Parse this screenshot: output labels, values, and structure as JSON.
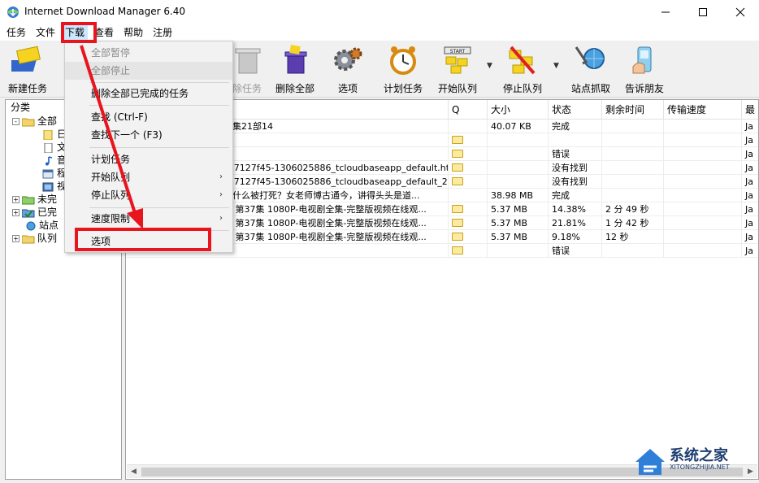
{
  "window": {
    "title": "Internet Download Manager 6.40"
  },
  "menubar": [
    "任务",
    "文件",
    "下载",
    "查看",
    "帮助",
    "注册"
  ],
  "toolbar": {
    "buttons": [
      {
        "label": "新建任务",
        "icon": "new-task-icon"
      },
      {
        "label": "除任务",
        "icon": "delete-task-icon"
      },
      {
        "label": "删除全部",
        "icon": "delete-all-icon"
      },
      {
        "label": "选项",
        "icon": "options-gear-icon"
      },
      {
        "label": "计划任务",
        "icon": "scheduler-clock-icon"
      },
      {
        "label": "开始队列",
        "icon": "start-queue-icon"
      },
      {
        "label": "停止队列",
        "icon": "stop-queue-icon"
      },
      {
        "label": "站点抓取",
        "icon": "site-grabber-icon"
      },
      {
        "label": "告诉朋友",
        "icon": "tell-friend-icon"
      }
    ]
  },
  "left_panel": {
    "header": "分类",
    "tree": [
      {
        "label": "全部",
        "expander": "-"
      },
      {
        "label": "日"
      },
      {
        "label": "文"
      },
      {
        "label": "音"
      },
      {
        "label": "程"
      },
      {
        "label": "视"
      },
      {
        "label": "未完",
        "expander": "+"
      },
      {
        "label": "已完",
        "expander": "+"
      },
      {
        "label": "站点"
      },
      {
        "label": "队列",
        "expander": "+"
      }
    ]
  },
  "file_list": {
    "columns": [
      "Q",
      "大小",
      "状态",
      "剩余时间",
      "传输速度",
      "最"
    ],
    "rows": [
      {
        "name": "合集21部14",
        "q": false,
        "size": "40.07 KB",
        "status": "完成",
        "remaining": "",
        "speed": "",
        "last": "Ja"
      },
      {
        "name": "",
        "q": true,
        "size": "",
        "status": "",
        "remaining": "",
        "speed": "",
        "last": "Ja"
      },
      {
        "name": "",
        "q": true,
        "size": "",
        "status": "错误",
        "remaining": "",
        "speed": "",
        "last": "Ja"
      },
      {
        "name": "s07127f45-1306025886_tcloudbaseapp_default.html",
        "q": true,
        "size": "",
        "status": "没有找到",
        "remaining": "",
        "speed": "",
        "last": "Ja"
      },
      {
        "name": "s07127f45-1306025886_tcloudbaseapp_default_2....",
        "q": true,
        "size": "",
        "status": "没有找到",
        "remaining": "",
        "speed": "",
        "last": "Ja"
      },
      {
        "name": "为什么被打死？女老师博古通今，讲得头头是道...",
        "q": false,
        "size": "38.98 MB",
        "status": "完成",
        "remaining": "",
        "speed": "",
        "last": "Ja"
      },
      {
        "name": "部 第37集 1080P-电视剧全集-完整版视频在线观...",
        "q": true,
        "size": "5.37 MB",
        "status": "14.38%",
        "remaining": "2 分 49 秒",
        "speed": "",
        "last": "Ja"
      },
      {
        "name": "部 第37集 1080P-电视剧全集-完整版视频在线观...",
        "q": true,
        "size": "5.37 MB",
        "status": "21.81%",
        "remaining": "1 分 42 秒",
        "speed": "",
        "last": "Ja"
      },
      {
        "name": "部 第37集 1080P-电视剧全集-完整版视频在线观...",
        "q": true,
        "size": "5.37 MB",
        "status": "9.18%",
        "remaining": "12 秒",
        "speed": "",
        "last": "Ja"
      },
      {
        "name": "",
        "q": true,
        "size": "",
        "status": "错误",
        "remaining": "",
        "speed": "",
        "last": "Ja"
      }
    ]
  },
  "download_menu": {
    "items": [
      {
        "label": "全部暂停",
        "disabled": true
      },
      {
        "label": "全部停止",
        "disabled": true
      },
      {
        "separator": true
      },
      {
        "label": "删除全部已完成的任务"
      },
      {
        "separator": true
      },
      {
        "label": "查找 (Ctrl-F)"
      },
      {
        "label": "查找下一个 (F3)"
      },
      {
        "separator": true
      },
      {
        "label": "计划任务"
      },
      {
        "label": "开始队列",
        "submenu": true
      },
      {
        "label": "停止队列",
        "submenu": true
      },
      {
        "separator": true
      },
      {
        "label": "速度限制",
        "submenu": true
      },
      {
        "separator": true
      },
      {
        "label": "选项"
      }
    ]
  },
  "watermark": {
    "name": "系统之家",
    "url": "XITONGZHIJIA.NET"
  },
  "colors": {
    "annotation_red": "#e8141e",
    "menu_highlight": "#cce8ff"
  }
}
